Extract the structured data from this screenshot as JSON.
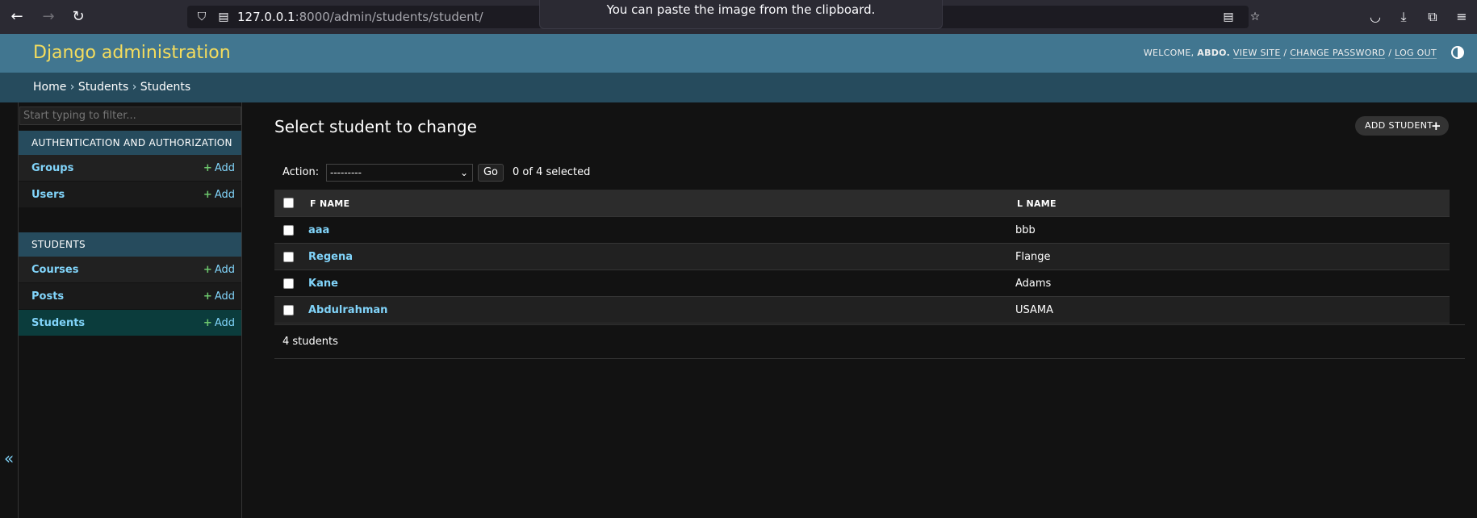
{
  "browser": {
    "url_host": "127.0.0.1",
    "url_rest": ":8000/admin/students/student/",
    "toast": "You can paste the image from the clipboard."
  },
  "header": {
    "branding": "Django administration",
    "welcome": "WELCOME,",
    "username": "ABDO.",
    "view_site": "VIEW SITE",
    "change_password": "CHANGE PASSWORD",
    "log_out": "LOG OUT",
    "separator": "/"
  },
  "breadcrumbs": {
    "home": "Home",
    "app": "Students",
    "current": "Students",
    "separator": "›"
  },
  "sidebar": {
    "filter_placeholder": "Start typing to filter...",
    "collapse_glyph": "«",
    "add_label": "Add",
    "add_glyph": "+",
    "modules": [
      {
        "caption": "AUTHENTICATION AND AUTHORIZATION",
        "items": [
          {
            "label": "Groups"
          },
          {
            "label": "Users"
          }
        ]
      },
      {
        "caption": "STUDENTS",
        "items": [
          {
            "label": "Courses"
          },
          {
            "label": "Posts"
          },
          {
            "label": "Students",
            "active": true
          }
        ]
      }
    ]
  },
  "main": {
    "title": "Select student to change",
    "add_button": "ADD STUDENT",
    "add_button_glyph": "+",
    "action_label": "Action:",
    "action_selected": "---------",
    "go_label": "Go",
    "counter": "0 of 4 selected",
    "columns": [
      "F NAME",
      "L NAME"
    ],
    "rows": [
      {
        "f_name": "aaa",
        "l_name": "bbb"
      },
      {
        "f_name": "Regena",
        "l_name": "Flange"
      },
      {
        "f_name": "Kane",
        "l_name": "Adams"
      },
      {
        "f_name": "Abdulrahman",
        "l_name": "USAMA"
      }
    ],
    "paginator": "4 students"
  },
  "colors": {
    "header_bg": "#417690",
    "breadcrumb_bg": "#264b5d",
    "branding": "#f5dd5d",
    "link": "#81d4fa",
    "page_bg": "#121212"
  },
  "icons": [
    "back-arrow-icon",
    "forward-arrow-icon",
    "reload-icon",
    "shield-icon",
    "page-icon",
    "reader-view-icon",
    "bookmark-star-icon",
    "pocket-icon",
    "download-icon",
    "extensions-icon",
    "menu-icon",
    "theme-toggle-icon",
    "collapse-sidebar-icon",
    "plus-icon"
  ]
}
